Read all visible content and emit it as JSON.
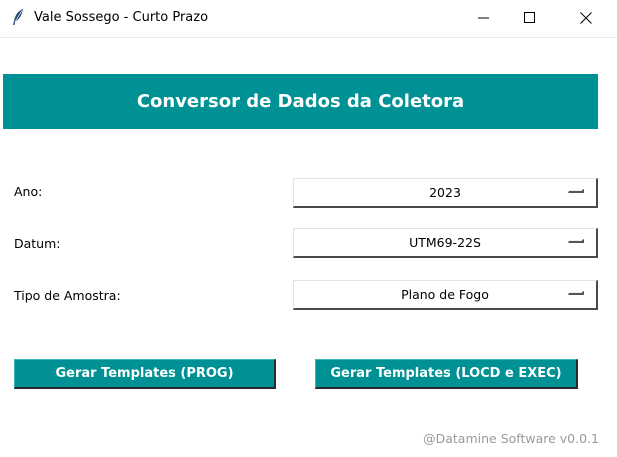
{
  "window": {
    "title": "Vale Sossego - Curto Prazo",
    "icon": "feather-icon",
    "controls": [
      "minimize-icon",
      "maximize-icon",
      "close-icon"
    ]
  },
  "header": {
    "title": "Conversor de Dados da Coletora",
    "background": "#009194",
    "text_color": "#ffffff"
  },
  "form": {
    "ano": {
      "label": "Ano:",
      "value": "2023"
    },
    "datum": {
      "label": "Datum:",
      "value": "UTM69-22S"
    },
    "tipo": {
      "label": "Tipo de Amostra:",
      "value": "Plano de Fogo"
    }
  },
  "actions": {
    "prog_label": "Gerar Templates (PROG)",
    "locd_label": "Gerar Templates (LOCD e EXEC)",
    "color": "#009194"
  },
  "footer": {
    "text": "@Datamine Software v0.0.1"
  }
}
